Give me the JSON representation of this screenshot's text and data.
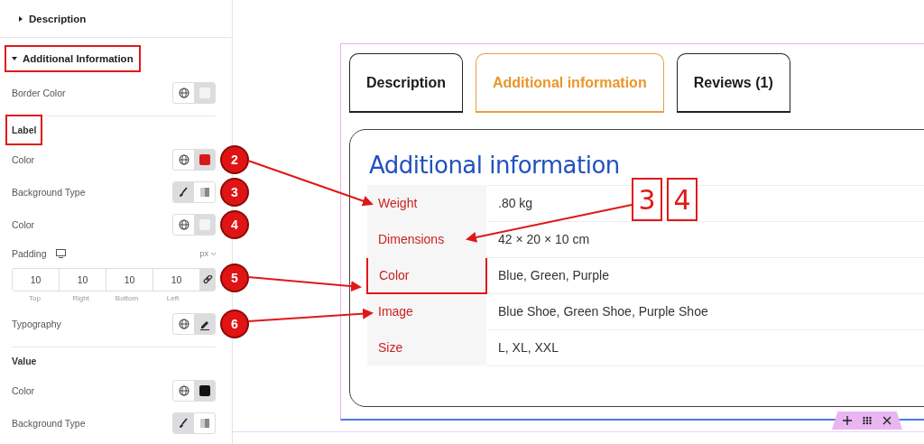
{
  "panel": {
    "sections": [
      {
        "title": "Description",
        "expanded": false,
        "highlighted": false
      },
      {
        "title": "Additional Information",
        "expanded": true,
        "highlighted": true
      }
    ],
    "controls": [
      {
        "kind": "color",
        "label": "Border Color",
        "color": "#f4f4f4"
      },
      {
        "kind": "divider"
      },
      {
        "kind": "heading",
        "label": "Label",
        "highlighted": true
      },
      {
        "kind": "color",
        "label": "Color",
        "color": "#d81818",
        "badge": "2"
      },
      {
        "kind": "bgtype",
        "label": "Background Type",
        "classic": true,
        "badge": "3"
      },
      {
        "kind": "color",
        "label": "Color",
        "color": "#f4f4f4",
        "badge": "4"
      },
      {
        "kind": "dimensions",
        "label": "Padding",
        "unit": "px",
        "linked": true,
        "badge": "5",
        "fields": [
          {
            "value": "10",
            "caption": "Top"
          },
          {
            "value": "10",
            "caption": "Right"
          },
          {
            "value": "10",
            "caption": "Bottom"
          },
          {
            "value": "10",
            "caption": "Left"
          }
        ]
      },
      {
        "kind": "typography",
        "label": "Typography",
        "badge": "6"
      },
      {
        "kind": "divider"
      },
      {
        "kind": "heading",
        "label": "Value",
        "highlighted": false
      },
      {
        "kind": "color",
        "label": "Color",
        "color": "#111111"
      },
      {
        "kind": "bgtype",
        "label": "Background Type",
        "classic": true
      }
    ]
  },
  "preview": {
    "tabs": [
      {
        "label": "Description",
        "selected": false
      },
      {
        "label": "Additional information",
        "selected": true
      },
      {
        "label": "Reviews (1)",
        "selected": false
      }
    ],
    "heading": "Additional information",
    "rows": [
      {
        "label": "Weight",
        "value": ".80 kg",
        "highlighted": false
      },
      {
        "label": "Dimensions",
        "value": "42 × 20 × 10 cm",
        "highlighted": false
      },
      {
        "label": "Color",
        "value": "Blue, Green, Purple",
        "highlighted": true
      },
      {
        "label": "Image",
        "value": "Blue Shoe, Green Shoe, Purple Shoe",
        "highlighted": false
      },
      {
        "label": "Size",
        "value": "L, XL, XXL",
        "highlighted": false
      }
    ]
  },
  "callouts": [
    "3",
    "4"
  ]
}
